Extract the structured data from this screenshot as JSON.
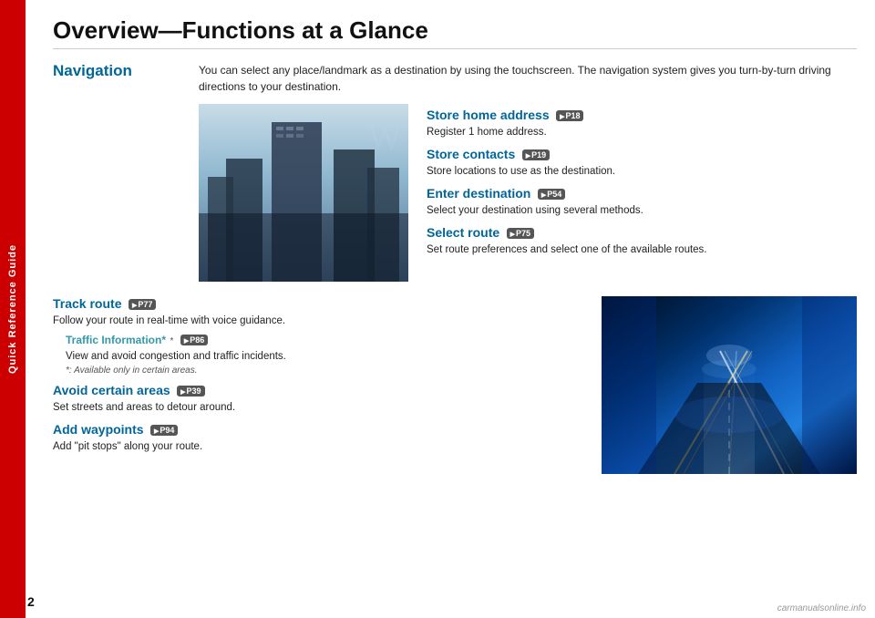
{
  "sidebar": {
    "label": "Quick Reference Guide"
  },
  "page": {
    "title": "Overview—Functions at a Glance",
    "number": "2",
    "watermark": "carmanualsonline.info"
  },
  "navigation": {
    "heading": "Navigation",
    "intro": "You can select any place/landmark as a destination by using the touchscreen. The navigation system gives you turn-by-turn driving directions to your destination.",
    "features": [
      {
        "title": "Store home address",
        "badge": "P18",
        "description": "Register 1 home address."
      },
      {
        "title": "Store contacts",
        "badge": "P19",
        "description": "Store locations to use as the destination."
      },
      {
        "title": "Enter destination",
        "badge": "P54",
        "description": "Select your destination using several methods."
      },
      {
        "title": "Select route",
        "badge": "P75",
        "description": "Set route preferences and select one of the available routes."
      }
    ],
    "bottom_features": [
      {
        "title": "Track route",
        "badge": "P77",
        "description": "Follow your route in real-time with voice guidance.",
        "sub_feature": {
          "title": "Traffic Information*",
          "badge": "P86",
          "description": "View and avoid congestion and traffic incidents.",
          "note": "*: Available only in certain areas."
        }
      },
      {
        "title": "Avoid certain areas",
        "badge": "P39",
        "description": "Set streets and areas to detour around."
      },
      {
        "title": "Add waypoints",
        "badge": "P94",
        "description": "Add \"pit stops\" along your route."
      }
    ]
  }
}
